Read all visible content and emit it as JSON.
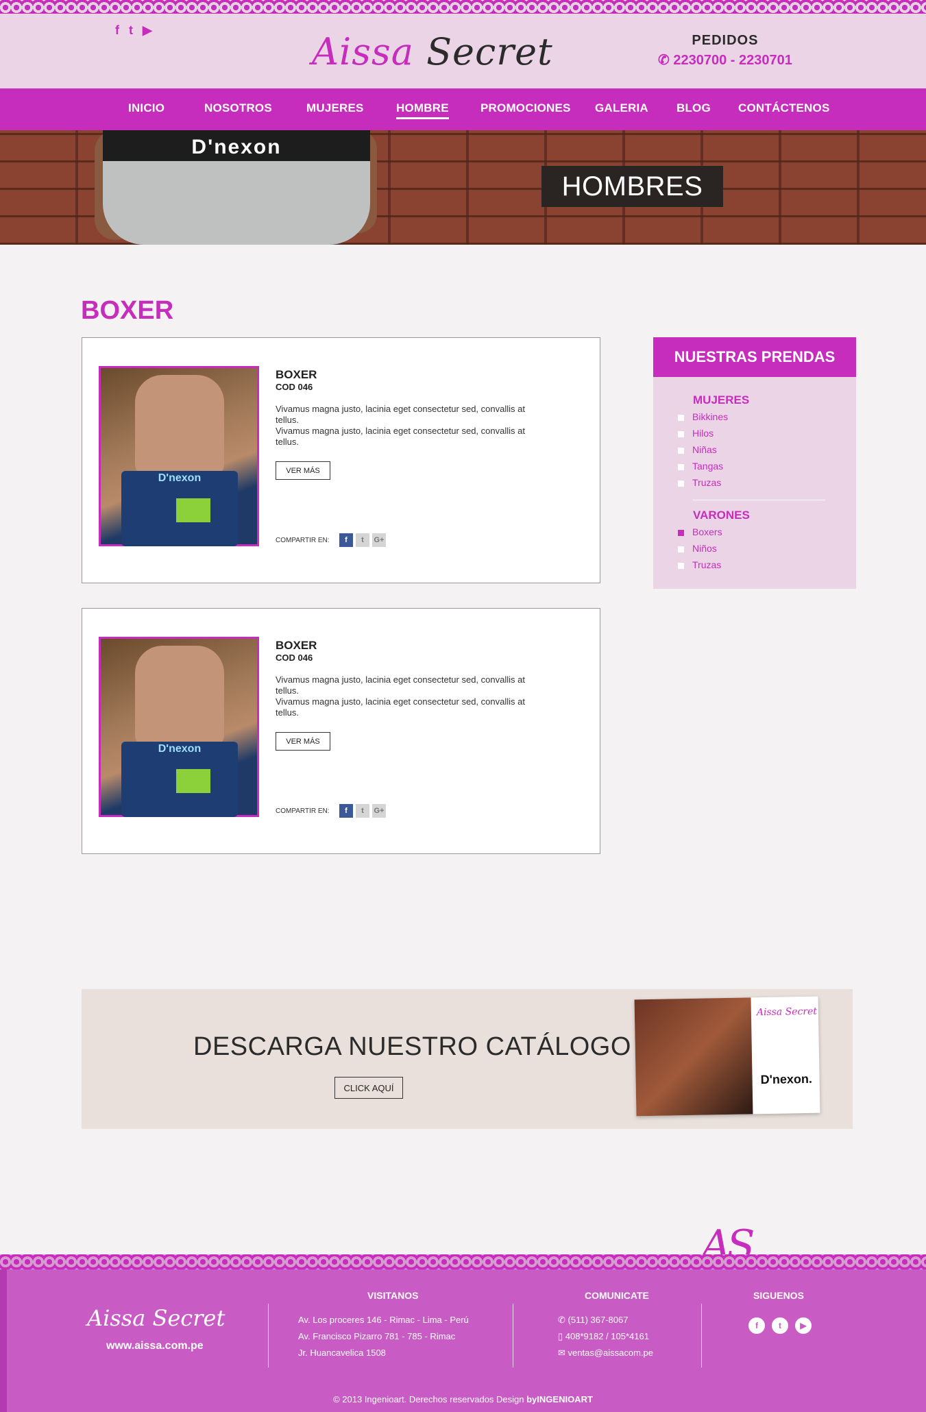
{
  "header": {
    "logo_first": "Aissa",
    "logo_second": "Secret",
    "social_icons": [
      "facebook-icon",
      "twitter-icon",
      "youtube-icon"
    ],
    "orders_label": "PEDIDOS",
    "orders_phones": "2230700 -  2230701"
  },
  "nav": {
    "items": [
      {
        "label": "INICIO"
      },
      {
        "label": "NOSOTROS"
      },
      {
        "label": "MUJERES"
      },
      {
        "label": "HOMBRE",
        "active": true
      },
      {
        "label": "PROMOCIONES"
      },
      {
        "label": "GALERIA"
      },
      {
        "label": "BLOG"
      },
      {
        "label": "CONTÁCTENOS"
      }
    ]
  },
  "hero": {
    "banner_brand": "D'nexon",
    "badge": "HOMBRES"
  },
  "main": {
    "section_title": "BOXER",
    "products": [
      {
        "name": "BOXER",
        "code": "COD 046",
        "description": "Vivamus magna justo, lacinia eget consectetur sed, convallis at tellus.\nVivamus magna justo, lacinia eget consectetur sed, convallis at tellus.",
        "button": "VER MÁS",
        "share_label": "COMPARTIR EN:",
        "image_brand": "D'nexon"
      },
      {
        "name": "BOXER",
        "code": "COD 046",
        "description": "Vivamus magna justo, lacinia eget consectetur sed, convallis at tellus.\nVivamus magna justo, lacinia eget consectetur sed, convallis at tellus.",
        "button": "VER MÁS",
        "share_label": "COMPARTIR EN:",
        "image_brand": "D'nexon"
      }
    ]
  },
  "sidebar": {
    "title": "NUESTRAS PRENDAS",
    "groups": [
      {
        "label": "MUJERES",
        "items": [
          "Bikkines",
          "Hilos",
          "Niñas",
          "Tangas",
          "Truzas"
        ]
      },
      {
        "label": "VARONES",
        "items": [
          "Boxers",
          "Niños",
          "Truzas"
        ],
        "selected": "Boxers"
      }
    ]
  },
  "catalog": {
    "title": "DESCARGA NUESTRO CATÁLOGO",
    "button": "CLICK AQUÍ",
    "cover_logo": "Aissa Secret",
    "cover_brand": "D'nexon."
  },
  "watermark": "AS",
  "footer": {
    "logo": "Aissa Secret",
    "url": "www.aissa.com.pe",
    "visit_title": "VISITANOS",
    "addresses": [
      "Av. Los proceres 146 - Rimac - Lima - Perú",
      "Av. Francisco Pizarro 781 - 785 - Rimac",
      "Jr. Huancavelica 1508"
    ],
    "contact_title": "COMUNICATE",
    "phone": "(511) 367-8067",
    "mobile": "408*9182 / 105*4161",
    "email": "ventas@aissacom.pe",
    "follow_title": "SIGUENOS",
    "copyright": "© 2013 Ingenioart. Derechos reservados Design ",
    "copyright_bold": "byINGENIOART"
  },
  "colors": {
    "brand_magenta": "#c62dbc",
    "header_bg": "#ead4e5",
    "footer_bg": "#c95cc4",
    "catalog_bg": "#e9e0db"
  }
}
